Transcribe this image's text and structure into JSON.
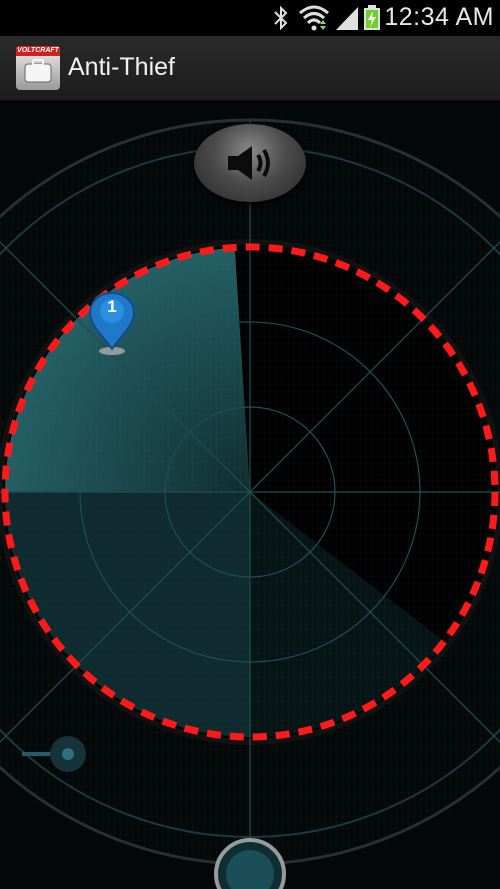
{
  "status_bar": {
    "time": "12:34 AM",
    "icons": [
      "bluetooth-icon",
      "wifi-icon",
      "signal-icon",
      "battery-charging-icon"
    ]
  },
  "app": {
    "title": "Anti-Thief",
    "icon_brand": "VOLTCRAFT",
    "icon_name": "briefcase-icon"
  },
  "radar": {
    "marker_label": "1",
    "controls": [
      "speaker-icon",
      "slider",
      "bottom-knob"
    ],
    "colors": {
      "range_ring": "#ff1a1a",
      "sweep": "#2f7f86",
      "grid": "#1d4f56",
      "marker": "#1f79c9"
    }
  }
}
